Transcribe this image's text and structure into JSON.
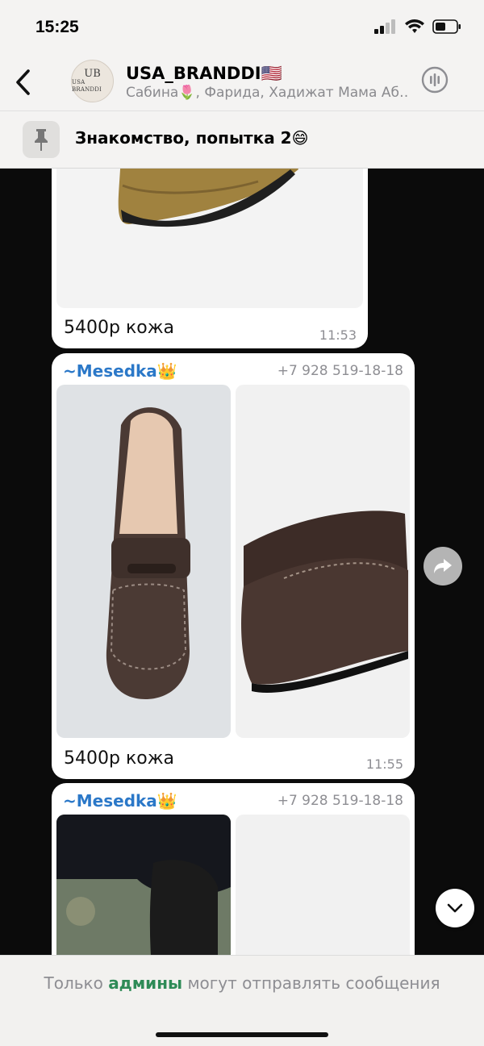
{
  "status_bar": {
    "time": "15:25"
  },
  "header": {
    "title": "USA_BRANDDI🇺🇸",
    "subtitle": "Сабина🌷, Фарида, Хадижат Мама Аб…",
    "avatar_text": "USA BRANDDI",
    "avatar_monogram": "UB"
  },
  "pinned": {
    "text": "Знакомство, попытка 2😄"
  },
  "messages": [
    {
      "caption": "5400р кожа",
      "time": "11:53"
    },
    {
      "sender": "~Mesedka👑",
      "phone": "+7 928 519-18-18",
      "caption": "5400р кожа",
      "time": "11:55"
    },
    {
      "sender": "~Mesedka👑",
      "phone": "+7 928 519-18-18"
    }
  ],
  "footer": {
    "prefix": "Только",
    "admins": "админы",
    "suffix": "могут отправлять сообщения"
  },
  "icons": [
    "back-chevron-icon",
    "call-icon",
    "pin-icon",
    "share-icon",
    "chevron-down-icon",
    "signal-icon",
    "wifi-icon",
    "battery-icon"
  ],
  "colors": {
    "sender": "#2b78c8",
    "admins": "#2e8b57",
    "header_bg": "#f4f3f2"
  }
}
